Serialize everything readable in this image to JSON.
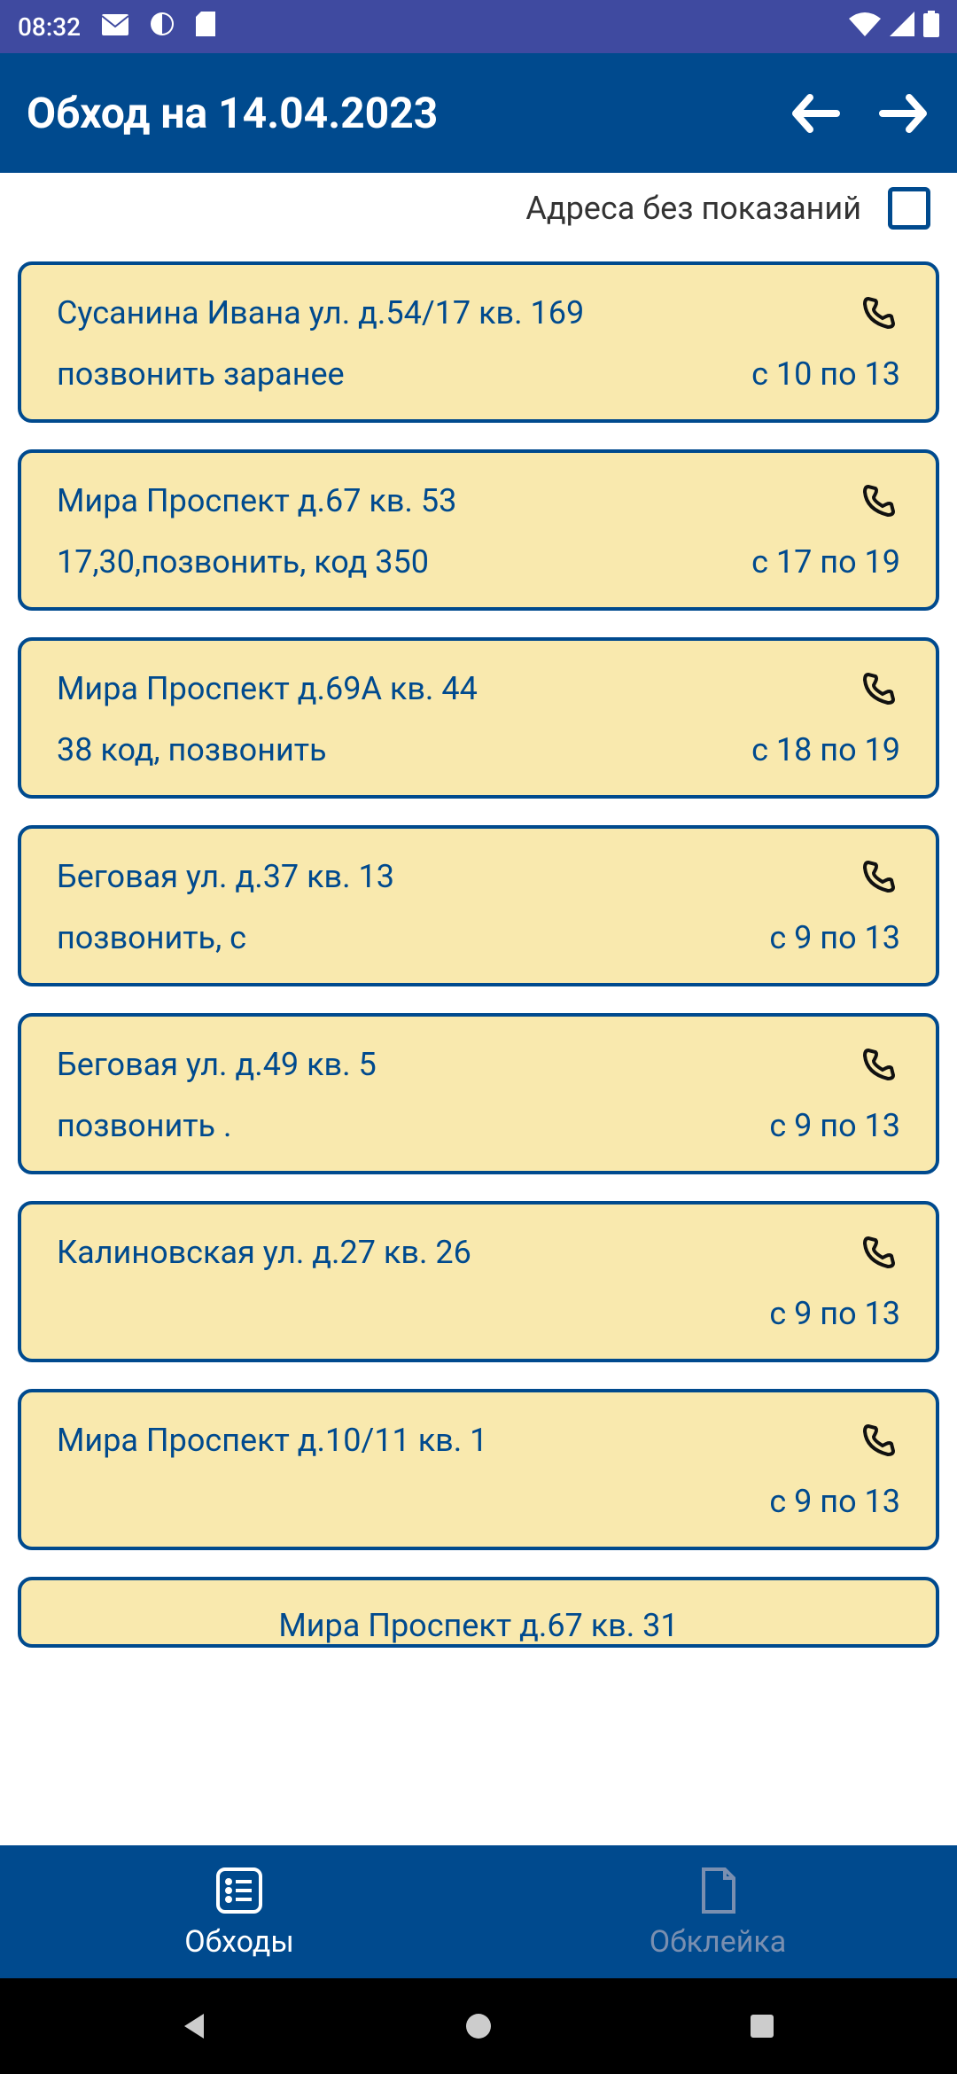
{
  "status": {
    "time": "08:32"
  },
  "header": {
    "title": "Обход на 14.04.2023"
  },
  "filter": {
    "label": "Адреса без показаний",
    "checked": false
  },
  "cards": [
    {
      "address": "Сусанина Ивана ул. д.54/17 кв. 169",
      "note": "позвонить заранее",
      "time": "с 10 по 13"
    },
    {
      "address": "Мира Проспект д.67 кв. 53",
      "note": "17,30,позвонить, код 350",
      "time": "с 17 по 19"
    },
    {
      "address": "Мира Проспект д.69А кв. 44",
      "note": "38 код, позвонить",
      "time": "с 18 по 19"
    },
    {
      "address": "Беговая ул. д.37 кв. 13",
      "note": "позвонить, с",
      "time": "с 9 по 13"
    },
    {
      "address": "Беговая ул. д.49 кв. 5",
      "note": "позвонить .",
      "time": "с 9 по 13"
    },
    {
      "address": "Калиновская ул. д.27 кв. 26",
      "note": "",
      "time": "с 9 по 13"
    },
    {
      "address": "Мира Проспект д.10/11 кв. 1",
      "note": "",
      "time": "с 9 по 13"
    },
    {
      "address": "Мира Проспект д.67 кв. 31",
      "note": "",
      "time": ""
    }
  ],
  "bottomNav": {
    "items": [
      {
        "label": "Обходы",
        "active": true
      },
      {
        "label": "Обклейка",
        "active": false
      }
    ]
  }
}
